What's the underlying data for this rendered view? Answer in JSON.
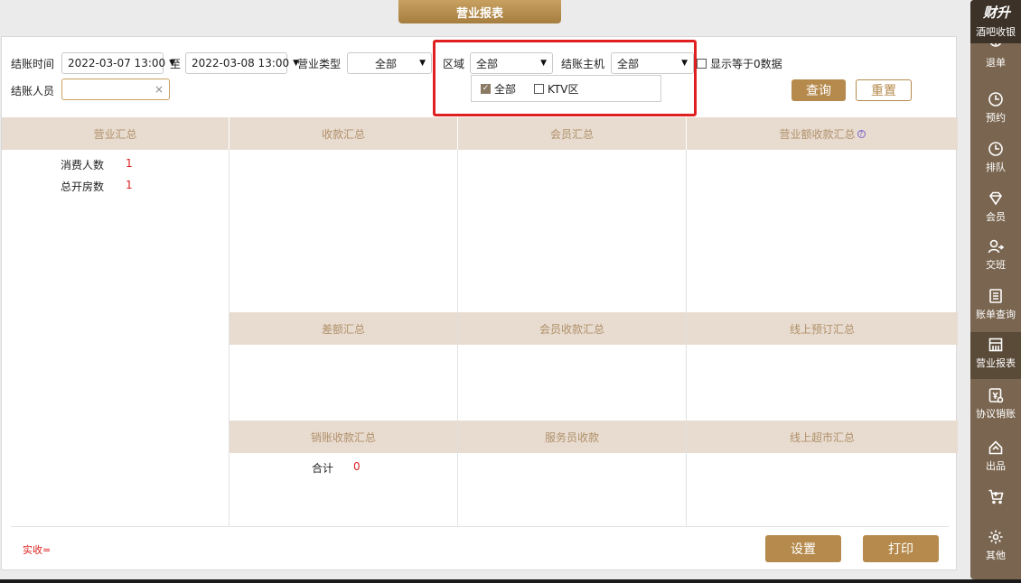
{
  "header": {
    "title": "营业报表"
  },
  "filters": {
    "checkout_time_label": "结账时间",
    "start_time": "2022-03-07 13:00",
    "to_label": "至",
    "end_time": "2022-03-08 13:00",
    "business_type_label": "营业类型",
    "business_type_value": "全部",
    "area_label": "区域",
    "area_value": "全部",
    "host_label": "结账主机",
    "host_value": "全部",
    "show_zero_label": "显示等于0数据",
    "operator_label": "结账人员",
    "operator_value": "",
    "clear_symbol": "×",
    "area_options": [
      {
        "label": "全部",
        "checked": true
      },
      {
        "label": "KTV区",
        "checked": false
      }
    ],
    "query_label": "查询",
    "reset_label": "重置"
  },
  "sections": {
    "business_summary": "营业汇总",
    "collection_summary": "收款汇总",
    "member_summary": "会员汇总",
    "revenue_collection_summary": "营业额收款汇总",
    "difference_summary": "差额汇总",
    "member_collection_summary": "会员收款汇总",
    "online_booking_summary": "线上预订汇总",
    "writeoff_collection_summary": "销账收款汇总",
    "waiter_collection": "服务员收款",
    "online_market_summary": "线上超市汇总"
  },
  "stats": {
    "consumers_label": "消费人数",
    "consumers_value": "1",
    "rooms_label": "总开房数",
    "rooms_value": "1",
    "total_label": "合计",
    "total_value": "0"
  },
  "footer": {
    "actual_label": "实收=",
    "settings_label": "设置",
    "print_label": "打印"
  },
  "sidebar": {
    "brand": "财升",
    "brand_sub": "酒吧收银",
    "items": [
      {
        "label": "退单",
        "icon": "refund-icon"
      },
      {
        "label": "预约",
        "icon": "clock-icon"
      },
      {
        "label": "排队",
        "icon": "clock-icon"
      },
      {
        "label": "会员",
        "icon": "diamond-icon"
      },
      {
        "label": "交班",
        "icon": "user-switch-icon"
      },
      {
        "label": "账单查询",
        "icon": "document-icon"
      },
      {
        "label": "营业报表",
        "icon": "report-icon"
      },
      {
        "label": "协议销账",
        "icon": "agreement-icon"
      },
      {
        "label": "出品",
        "icon": "output-icon"
      },
      {
        "label": "",
        "icon": "cart-icon"
      },
      {
        "label": "其他",
        "icon": "gear-icon"
      }
    ]
  },
  "colors": {
    "accent": "#b58a4c",
    "section_bg": "#e8dcd0",
    "section_text": "#b0906a",
    "sidebar_bg": "#7a6650",
    "value_red": "#dd2222"
  }
}
